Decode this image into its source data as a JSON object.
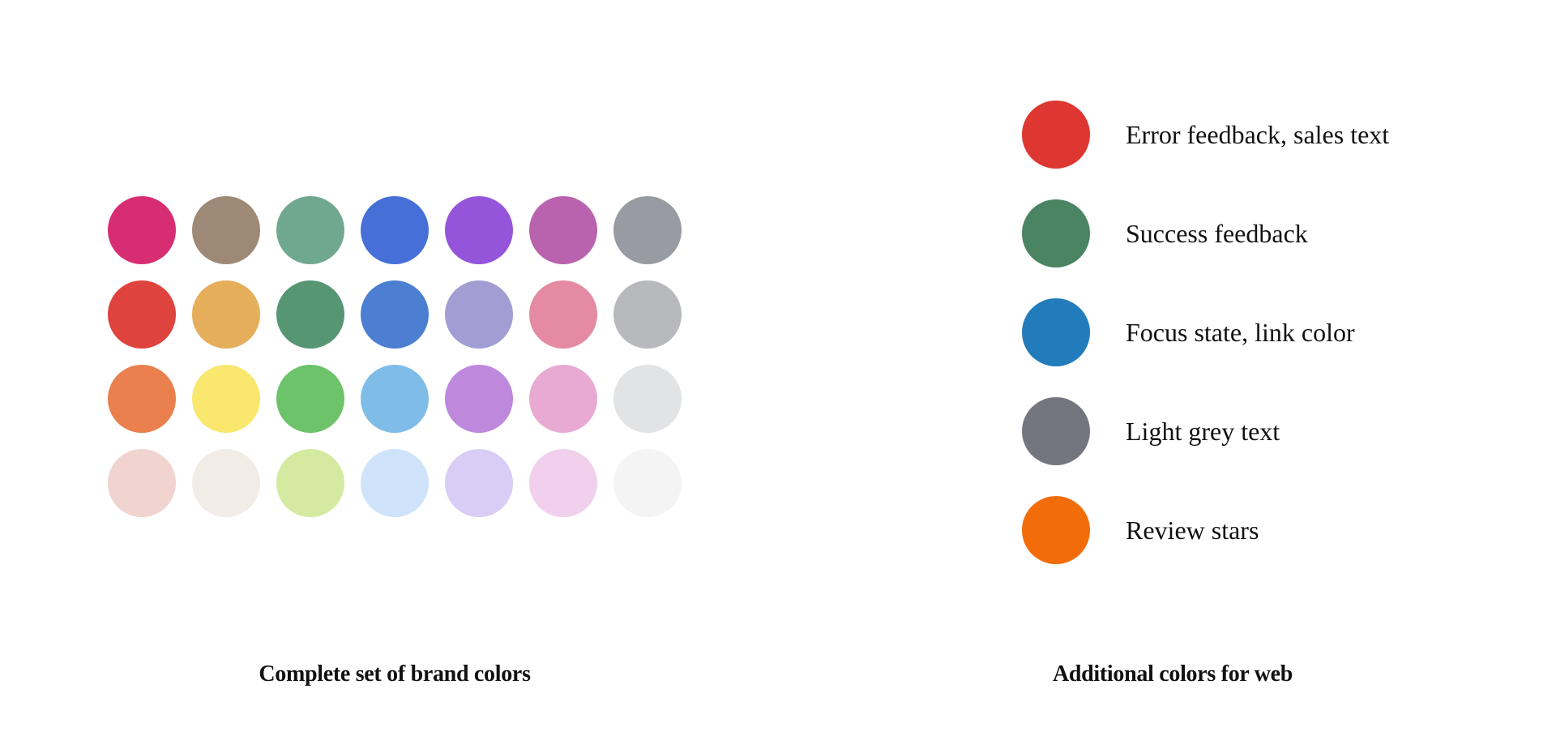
{
  "brand_colors": {
    "caption": "Complete set of brand colors",
    "rows": [
      [
        "#d72e73",
        "#9e8976",
        "#6fa88f",
        "#4670d8",
        "#9455db",
        "#b963ae",
        "#989ba2"
      ],
      [
        "#df433d",
        "#e5ae5b",
        "#569673",
        "#4c7fd1",
        "#a29ed4",
        "#e48aa3",
        "#b8b9bd"
      ],
      [
        "#e9804e",
        "#f9e76e",
        "#6cc369",
        "#7fbce8",
        "#be88dd",
        "#e8aad3",
        "#e2e3e5"
      ],
      [
        "#f1d3cf",
        "#f1ede6",
        "#d5eaa1",
        "#cfe3fa",
        "#d9cdf5",
        "#f0d0ec",
        "#f4f4f4"
      ]
    ]
  },
  "web_colors": {
    "caption": "Additional colors for web",
    "items": [
      {
        "color": "#de3731",
        "label": "Error feedback, sales text"
      },
      {
        "color": "#4b8462",
        "label": "Success feedback"
      },
      {
        "color": "#227cbc",
        "label": "Focus state, link color"
      },
      {
        "color": "#73767e",
        "label": "Light grey text"
      },
      {
        "color": "#f26c0a",
        "label": "Review stars"
      }
    ]
  }
}
